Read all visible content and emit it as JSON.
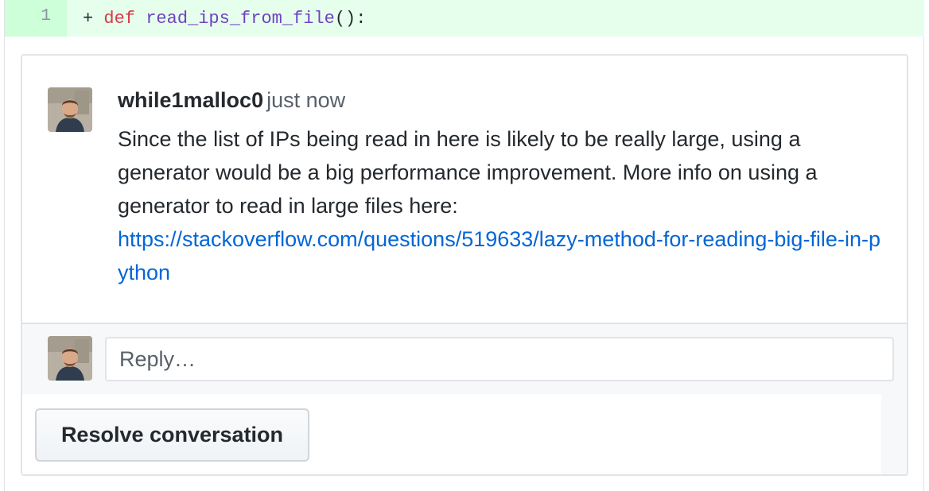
{
  "diff": {
    "line_number": "1",
    "prefix": "+ ",
    "keyword": "def",
    "function_name": "read_ips_from_file",
    "rest": "():"
  },
  "comment": {
    "author": "while1malloc0",
    "timestamp": "just now",
    "body": "Since the list of IPs being read in here is likely to be really large, using a generator would be a big performance improvement. More info on using a generator to read in large files here:",
    "link_text": "https://stackoverflow.com/questions/519633/lazy-method-for-reading-big-file-in-python"
  },
  "reply": {
    "placeholder": "Reply…"
  },
  "actions": {
    "resolve_label": "Resolve conversation"
  },
  "colors": {
    "diff_added_bg": "#e6ffed",
    "diff_number_bg": "#cdffd8",
    "link": "#0366d6",
    "keyword": "#d73a49",
    "function": "#6f42c1"
  }
}
